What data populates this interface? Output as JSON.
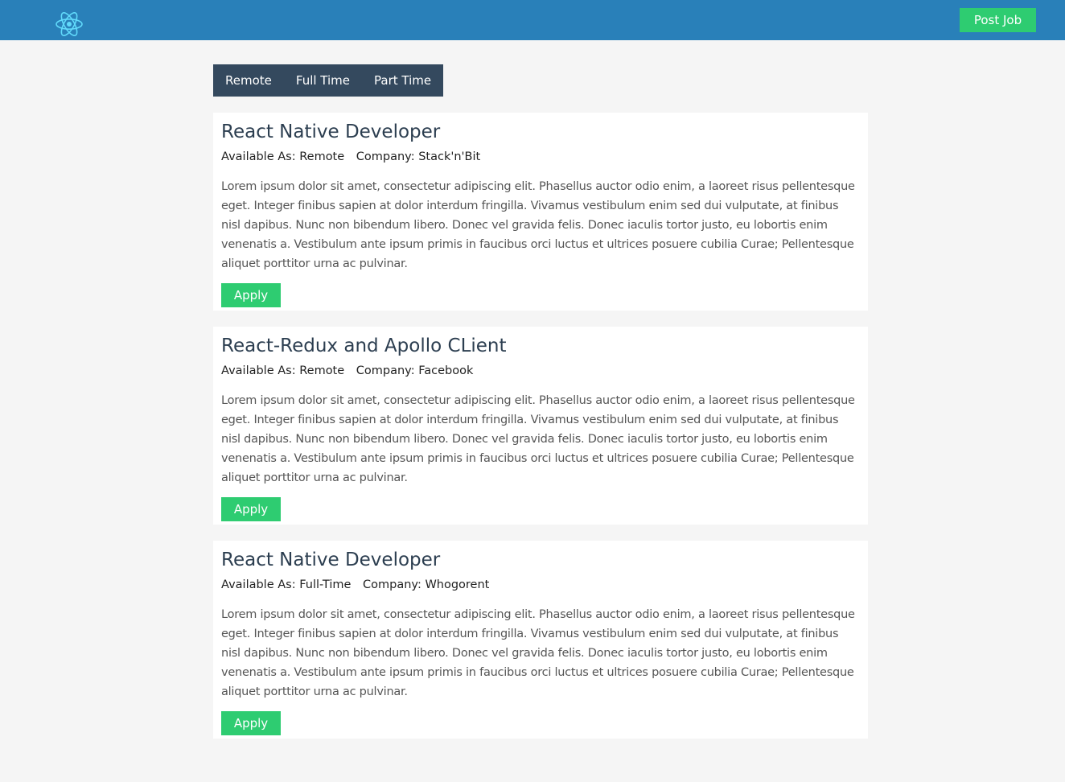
{
  "header": {
    "logo_icon": "react-atom-icon",
    "post_job_label": "Post Job",
    "bar_color": "#2980b9",
    "accent_color": "#2ecc71",
    "logo_color": "#61dafb"
  },
  "filters": {
    "items": [
      "Remote",
      "Full Time",
      "Part Time"
    ],
    "bar_color": "#34495e"
  },
  "jobs": [
    {
      "title": "React Native Developer",
      "available_label": "Available As:",
      "available": "Remote",
      "company_label": "Company:",
      "company": "Stack'n'Bit",
      "description": "Lorem ipsum dolor sit amet, consectetur adipiscing elit. Phasellus auctor odio enim, a laoreet risus pellentesque eget. Integer finibus sapien at dolor interdum fringilla. Vivamus vestibulum enim sed dui vulputate, at finibus nisl dapibus. Nunc non bibendum libero. Donec vel gravida felis. Donec iaculis tortor justo, eu lobortis enim venenatis a. Vestibulum ante ipsum primis in faucibus orci luctus et ultrices posuere cubilia Curae; Pellentesque aliquet porttitor urna ac pulvinar.",
      "apply_label": "Apply"
    },
    {
      "title": "React-Redux and Apollo CLient",
      "available_label": "Available As:",
      "available": "Remote",
      "company_label": "Company:",
      "company": "Facebook",
      "description": "Lorem ipsum dolor sit amet, consectetur adipiscing elit. Phasellus auctor odio enim, a laoreet risus pellentesque eget. Integer finibus sapien at dolor interdum fringilla. Vivamus vestibulum enim sed dui vulputate, at finibus nisl dapibus. Nunc non bibendum libero. Donec vel gravida felis. Donec iaculis tortor justo, eu lobortis enim venenatis a. Vestibulum ante ipsum primis in faucibus orci luctus et ultrices posuere cubilia Curae; Pellentesque aliquet porttitor urna ac pulvinar.",
      "apply_label": "Apply"
    },
    {
      "title": "React Native Developer",
      "available_label": "Available As:",
      "available": "Full-Time",
      "company_label": "Company:",
      "company": "Whogorent",
      "description": "Lorem ipsum dolor sit amet, consectetur adipiscing elit. Phasellus auctor odio enim, a laoreet risus pellentesque eget. Integer finibus sapien at dolor interdum fringilla. Vivamus vestibulum enim sed dui vulputate, at finibus nisl dapibus. Nunc non bibendum libero. Donec vel gravida felis. Donec iaculis tortor justo, eu lobortis enim venenatis a. Vestibulum ante ipsum primis in faucibus orci luctus et ultrices posuere cubilia Curae; Pellentesque aliquet porttitor urna ac pulvinar.",
      "apply_label": "Apply"
    }
  ]
}
